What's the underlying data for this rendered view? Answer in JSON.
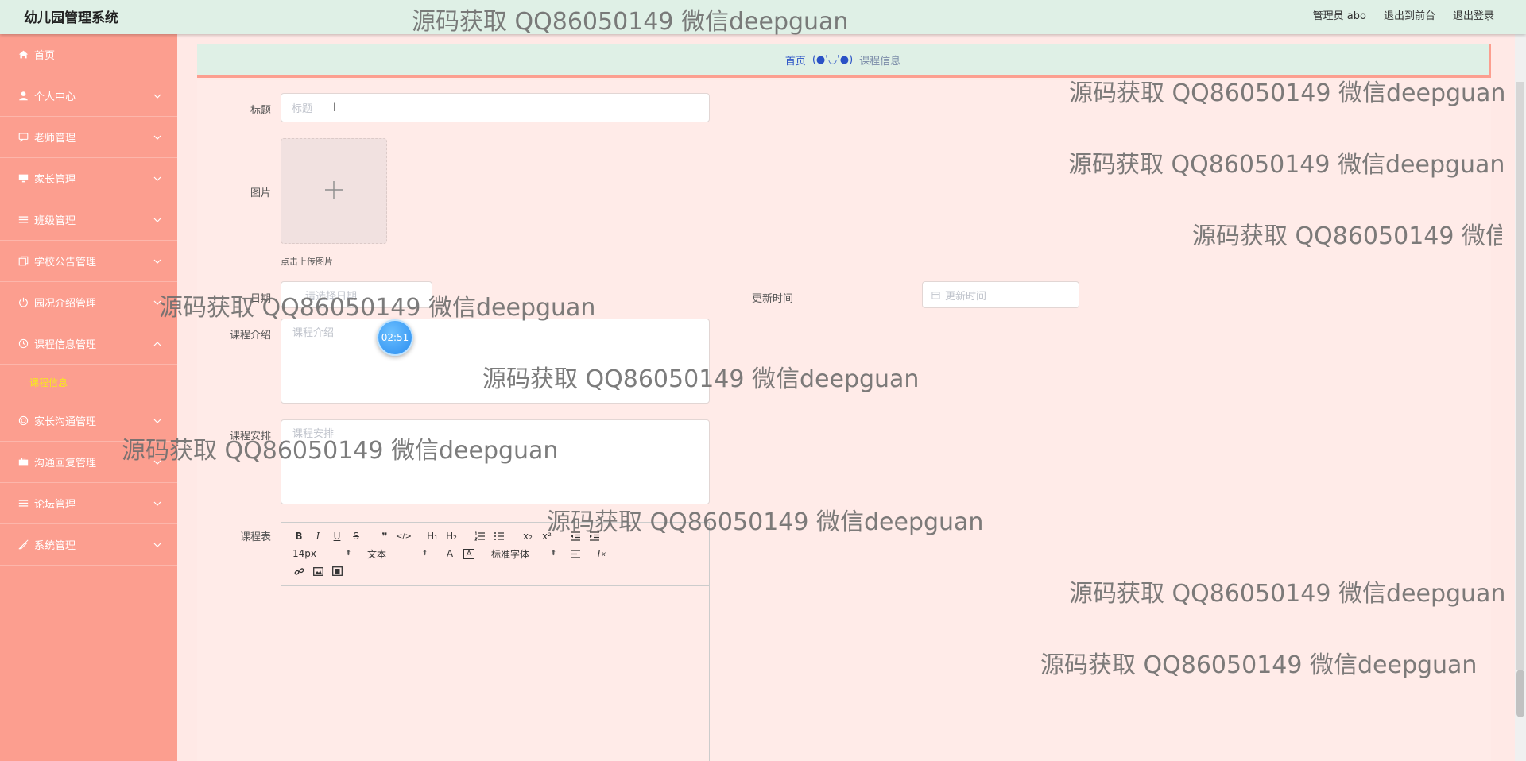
{
  "app": {
    "title": "幼儿园管理系统",
    "user_label": "管理员 abo",
    "front_link": "退出到前台",
    "logout_link": "退出登录"
  },
  "sidebar": {
    "items": [
      {
        "label": "首页",
        "icon": "home-icon"
      },
      {
        "label": "个人中心",
        "icon": "user-icon"
      },
      {
        "label": "老师管理",
        "icon": "chat-icon"
      },
      {
        "label": "家长管理",
        "icon": "monitor-icon"
      },
      {
        "label": "班级管理",
        "icon": "list-icon"
      },
      {
        "label": "学校公告管理",
        "icon": "copy-icon"
      },
      {
        "label": "园况介绍管理",
        "icon": "power-icon"
      },
      {
        "label": "课程信息管理",
        "icon": "clock-icon"
      },
      {
        "label": "家长沟通管理",
        "icon": "globe-icon"
      },
      {
        "label": "沟通回复管理",
        "icon": "briefcase-icon"
      },
      {
        "label": "论坛管理",
        "icon": "list-icon"
      },
      {
        "label": "系统管理",
        "icon": "pen-off-icon"
      }
    ],
    "subitem": "课程信息"
  },
  "breadcrumb": {
    "home": "首页",
    "sep": "(●'◡'●)",
    "current": "课程信息"
  },
  "form": {
    "title_label": "标题",
    "title_placeholder": "标题",
    "image_label": "图片",
    "upload_tip": "点击上传图片",
    "date_label": "日期",
    "date_placeholder": "请选择日期",
    "update_label": "更新时间",
    "update_placeholder": "更新时间",
    "intro_label": "课程介绍",
    "intro_placeholder": "课程介绍",
    "schedule_text_label": "课程安排",
    "schedule_text_placeholder": "课程安排",
    "schedule_label": "课程表"
  },
  "editor": {
    "font_size": "14px",
    "format": "文本",
    "font_family": "标准字体"
  },
  "timer": "02:51",
  "watermark": "源码获取 QQ86050149 微信deepguan"
}
